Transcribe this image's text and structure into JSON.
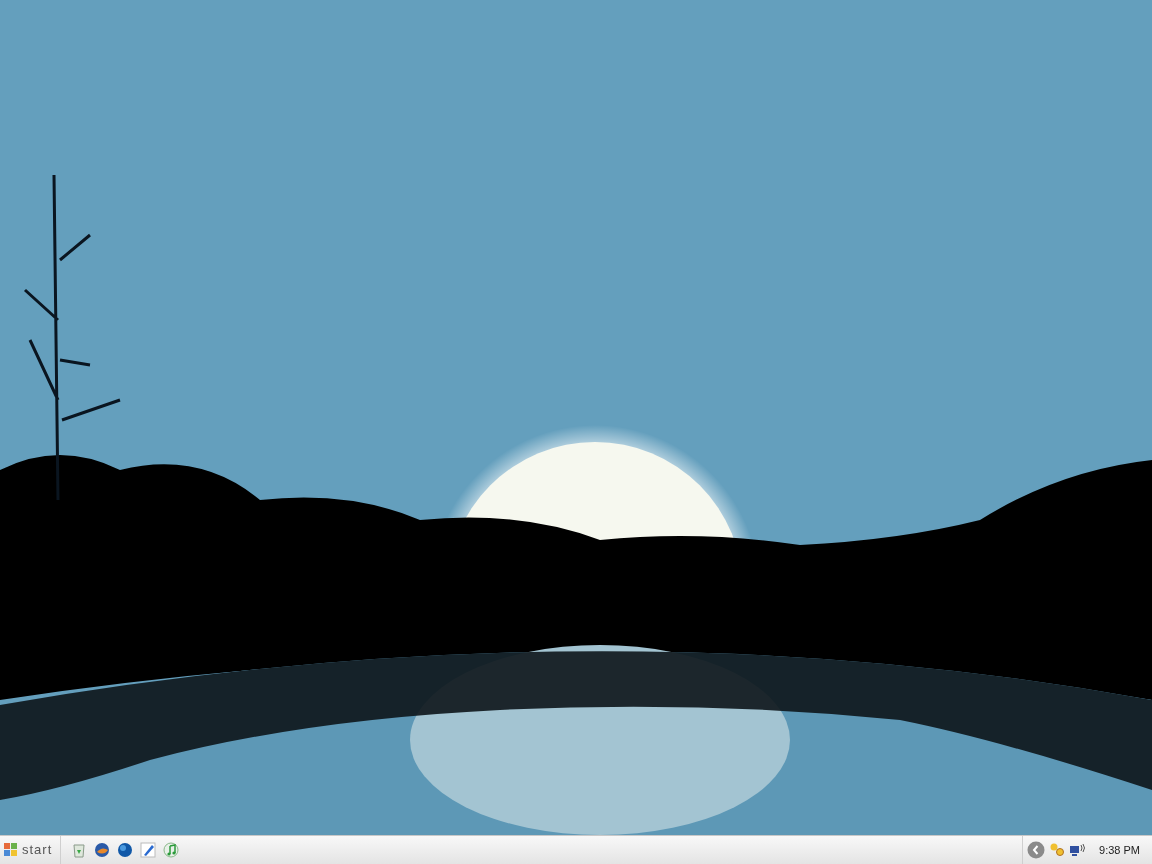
{
  "taskbar": {
    "start_button": {
      "label": "start"
    },
    "tray": {
      "clock": "9:38 PM"
    }
  }
}
